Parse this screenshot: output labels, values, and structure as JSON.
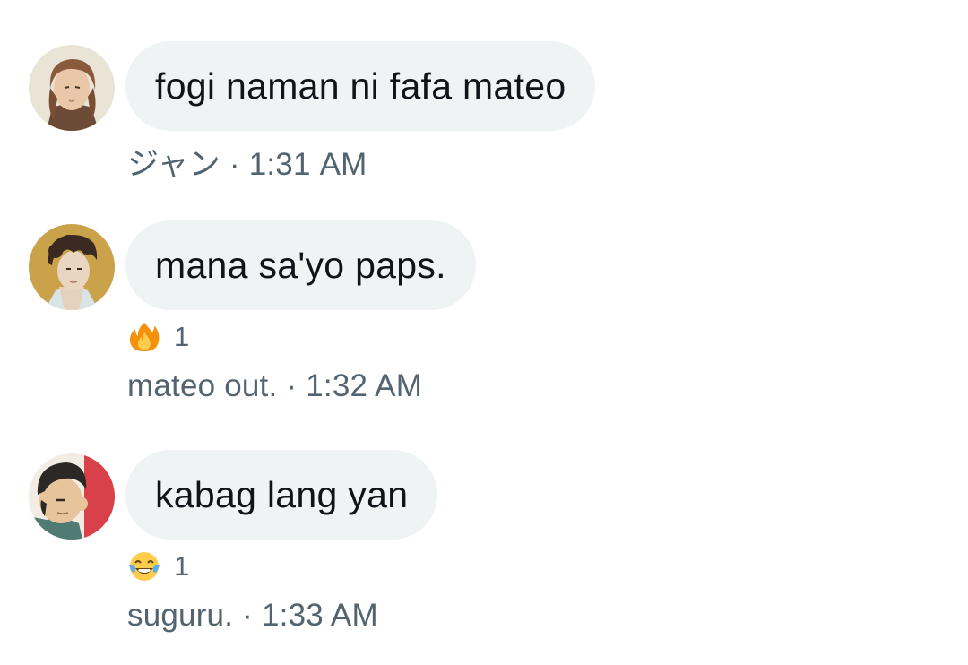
{
  "messages": [
    {
      "text": "fogi naman ni fafa mateo",
      "author": "ジャン",
      "separator": "·",
      "time": "1:31 AM",
      "avatar": "brown-haired-man-avatar"
    },
    {
      "text": "mana sa'yo paps.",
      "author": "mateo out.",
      "separator": "·",
      "time": "1:32 AM",
      "avatar": "curly-haired-man-avatar",
      "reaction": {
        "icon": "fire-emoji-icon",
        "count": "1"
      }
    },
    {
      "text": "kabag lang yan",
      "author": "suguru.",
      "separator": "·",
      "time": "1:33 AM",
      "avatar": "dark-haired-man-avatar",
      "reaction": {
        "icon": "tears-of-joy-emoji-icon",
        "count": "1"
      }
    }
  ],
  "colors": {
    "bubble_background": "#eff3f4",
    "message_text": "#0f1419",
    "meta_text": "#536471"
  }
}
